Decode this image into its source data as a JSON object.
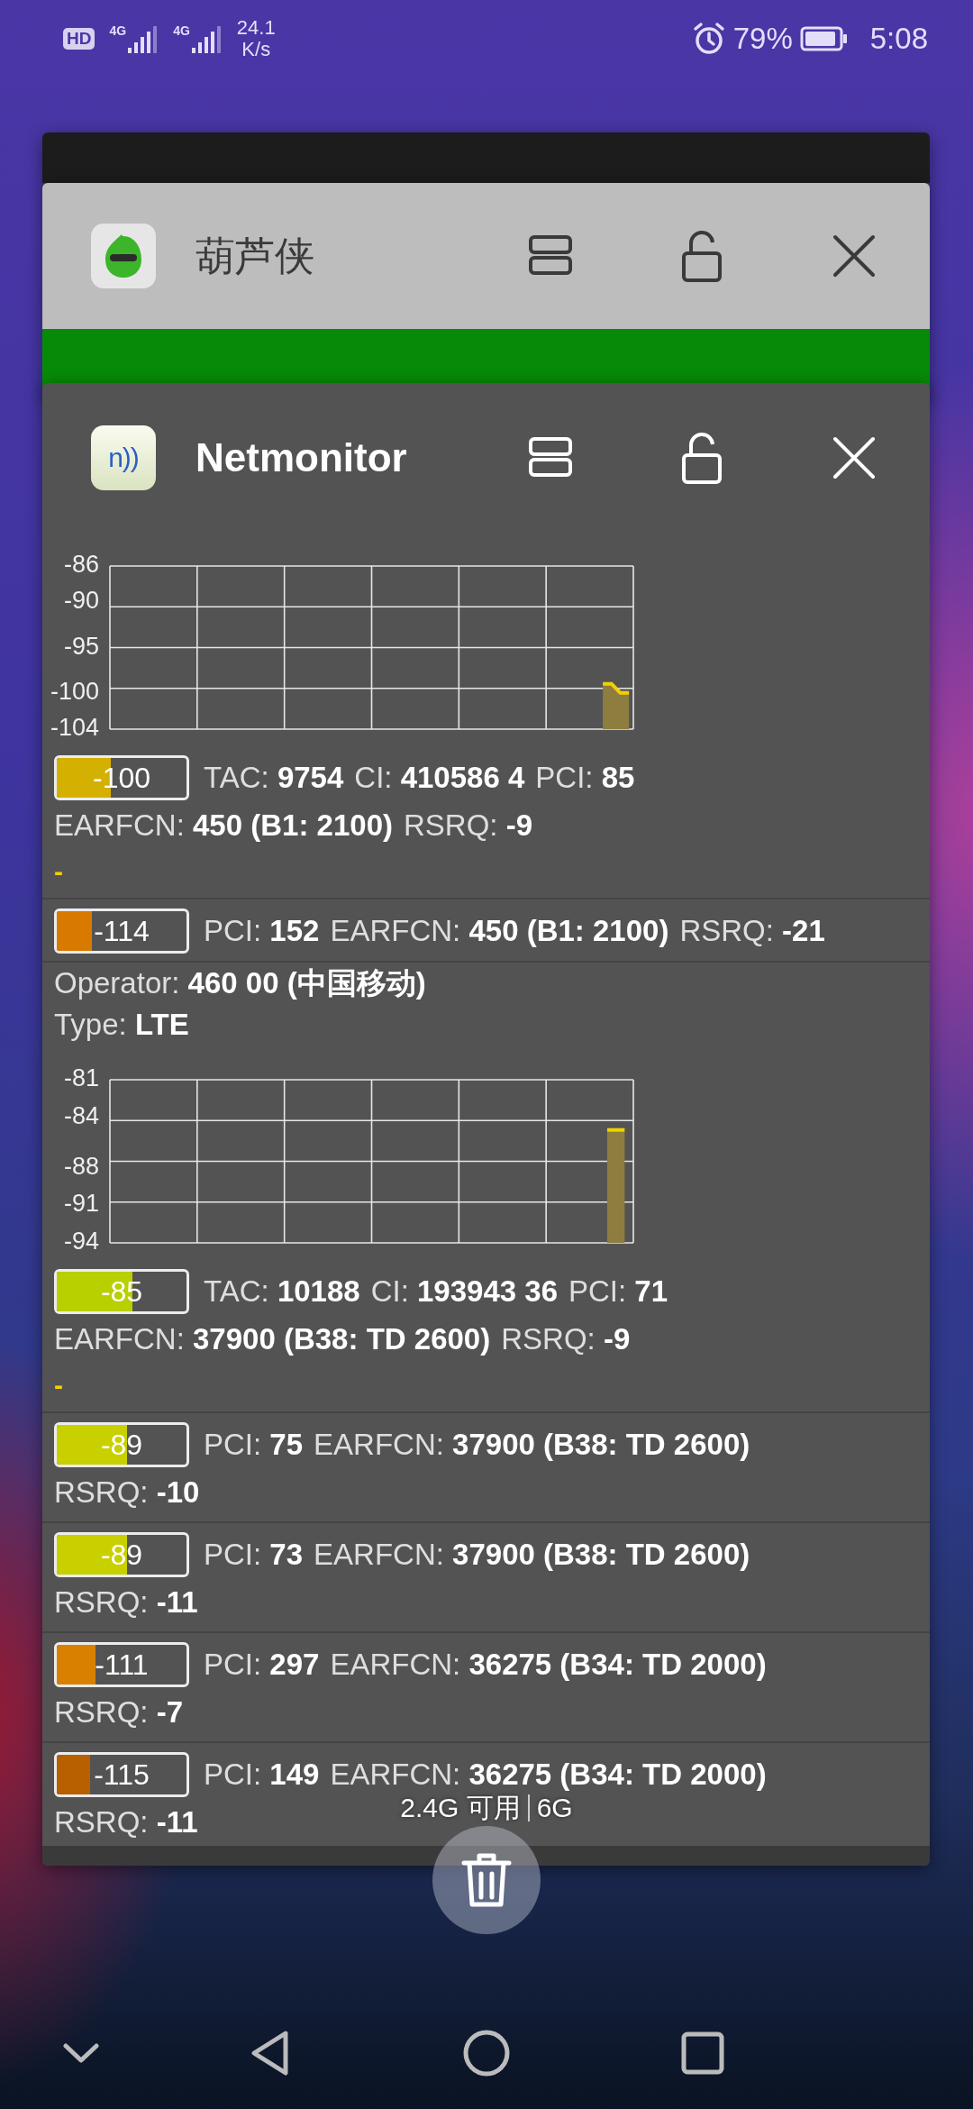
{
  "status_bar": {
    "hd_label": "HD",
    "sim1_type": "4G",
    "sim2_type": "4G",
    "net_speed": "24.1",
    "net_speed_unit": "K/s",
    "battery": "79%",
    "time": "5:08"
  },
  "background_app": {
    "title": "葫芦侠"
  },
  "netmonitor": {
    "title": "Netmonitor",
    "logo_text": "n))",
    "sections": [
      {
        "chart_data": {
          "type": "line",
          "categories": [
            null,
            null,
            null,
            null,
            null,
            null,
            null,
            null,
            null,
            null,
            null,
            null,
            null,
            null,
            null,
            null,
            null,
            null,
            null,
            null,
            null,
            null,
            null,
            null,
            null,
            null,
            null,
            null,
            null,
            null,
            null,
            null,
            null,
            null,
            null,
            null,
            null,
            null,
            null,
            null,
            null,
            null,
            null,
            null,
            null,
            null,
            null,
            null,
            null,
            null,
            null,
            null,
            null,
            null,
            null,
            null,
            null,
            null,
            null,
            null
          ],
          "ylim": [
            -104,
            -86
          ],
          "yticks": [
            {
              "value": -86,
              "label": "-86"
            },
            {
              "value": -90,
              "label": "-90"
            },
            {
              "value": -95,
              "label": "-95"
            },
            {
              "value": -100,
              "label": "-100"
            },
            {
              "value": -104,
              "label": "-104"
            }
          ],
          "series": [
            {
              "color": "#f2d000",
              "values": [
                null,
                null,
                null,
                null,
                null,
                null,
                null,
                null,
                null,
                null,
                null,
                null,
                null,
                null,
                null,
                null,
                null,
                null,
                null,
                null,
                null,
                null,
                null,
                null,
                null,
                null,
                null,
                null,
                null,
                null,
                null,
                null,
                null,
                null,
                null,
                null,
                null,
                null,
                null,
                null,
                null,
                null,
                null,
                null,
                null,
                null,
                null,
                null,
                null,
                null,
                null,
                null,
                null,
                null,
                null,
                null,
                -99,
                -99,
                -100,
                -100
              ]
            }
          ]
        },
        "cells": [
          {
            "kind": "serving",
            "rsrp": "-100",
            "level": 0.42,
            "color": "#d4b000",
            "marker": "-",
            "lines": [
              [
                "TAC: **9754**",
                "CI: **410586 4**",
                "PCI: **85**"
              ],
              [
                "EARFCN: **450 (B1: 2100)**",
                "RSRQ: **-9**"
              ]
            ]
          },
          {
            "kind": "neighbor",
            "rsrp": "-114",
            "level": 0.27,
            "color": "#d97a00",
            "lines": [
              [
                "PCI: **152**",
                "EARFCN: **450 (B1: 2100)**",
                "RSRQ: **-21**"
              ]
            ]
          }
        ]
      },
      {
        "operator": "Operator: **460 00 (中国移动)**",
        "type": "Type: **LTE**",
        "chart_data": {
          "type": "line",
          "categories": [
            null,
            null,
            null,
            null,
            null,
            null,
            null,
            null,
            null,
            null,
            null,
            null,
            null,
            null,
            null,
            null,
            null,
            null,
            null,
            null,
            null,
            null,
            null,
            null,
            null,
            null,
            null,
            null,
            null,
            null
          ],
          "ylim": [
            -94,
            -81
          ],
          "yticks": [
            {
              "value": -81,
              "label": "-81"
            },
            {
              "value": -84,
              "label": "-84"
            },
            {
              "value": -88,
              "label": "-88"
            },
            {
              "value": -91,
              "label": "-91"
            },
            {
              "value": -94,
              "label": "-94"
            }
          ],
          "series": [
            {
              "color": "#f2d000",
              "values": [
                null,
                null,
                null,
                null,
                null,
                null,
                null,
                null,
                null,
                null,
                null,
                null,
                null,
                null,
                null,
                null,
                null,
                null,
                null,
                null,
                null,
                null,
                null,
                null,
                null,
                null,
                null,
                null,
                -85,
                -85
              ]
            }
          ]
        },
        "cells": [
          {
            "kind": "serving",
            "rsrp": "-85",
            "level": 0.58,
            "color": "#b8cf00",
            "marker": "-",
            "lines": [
              [
                "TAC: **10188**",
                "CI: **193943 36**",
                "PCI: **71**"
              ],
              [
                "EARFCN: **37900 (B38: TD 2600)**",
                "RSRQ: **-9**"
              ]
            ]
          },
          {
            "kind": "neighbor",
            "rsrp": "-89",
            "level": 0.54,
            "color": "#c8d000",
            "lines": [
              [
                "PCI: **75**",
                "EARFCN: **37900 (B38: TD 2600)**"
              ],
              [
                "RSRQ: **-10**"
              ]
            ]
          },
          {
            "kind": "neighbor",
            "rsrp": "-89",
            "level": 0.54,
            "color": "#c8d000",
            "lines": [
              [
                "PCI: **73**",
                "EARFCN: **37900 (B38: TD 2600)**"
              ],
              [
                "RSRQ: **-11**"
              ]
            ]
          },
          {
            "kind": "neighbor",
            "rsrp": "-111",
            "level": 0.3,
            "color": "#d98000",
            "lines": [
              [
                "PCI: **297**",
                "EARFCN: **36275 (B34: TD 2000)**"
              ],
              [
                "RSRQ: **-7**"
              ]
            ]
          },
          {
            "kind": "neighbor",
            "rsrp": "-115",
            "level": 0.26,
            "color": "#b85f00",
            "lines": [
              [
                "PCI: **149**",
                "EARFCN: **36275 (B34: TD 2000)**"
              ],
              [
                "RSRQ: **-11**"
              ]
            ]
          }
        ]
      }
    ]
  },
  "memory": {
    "available": "2.4G 可用",
    "total": "6G"
  }
}
